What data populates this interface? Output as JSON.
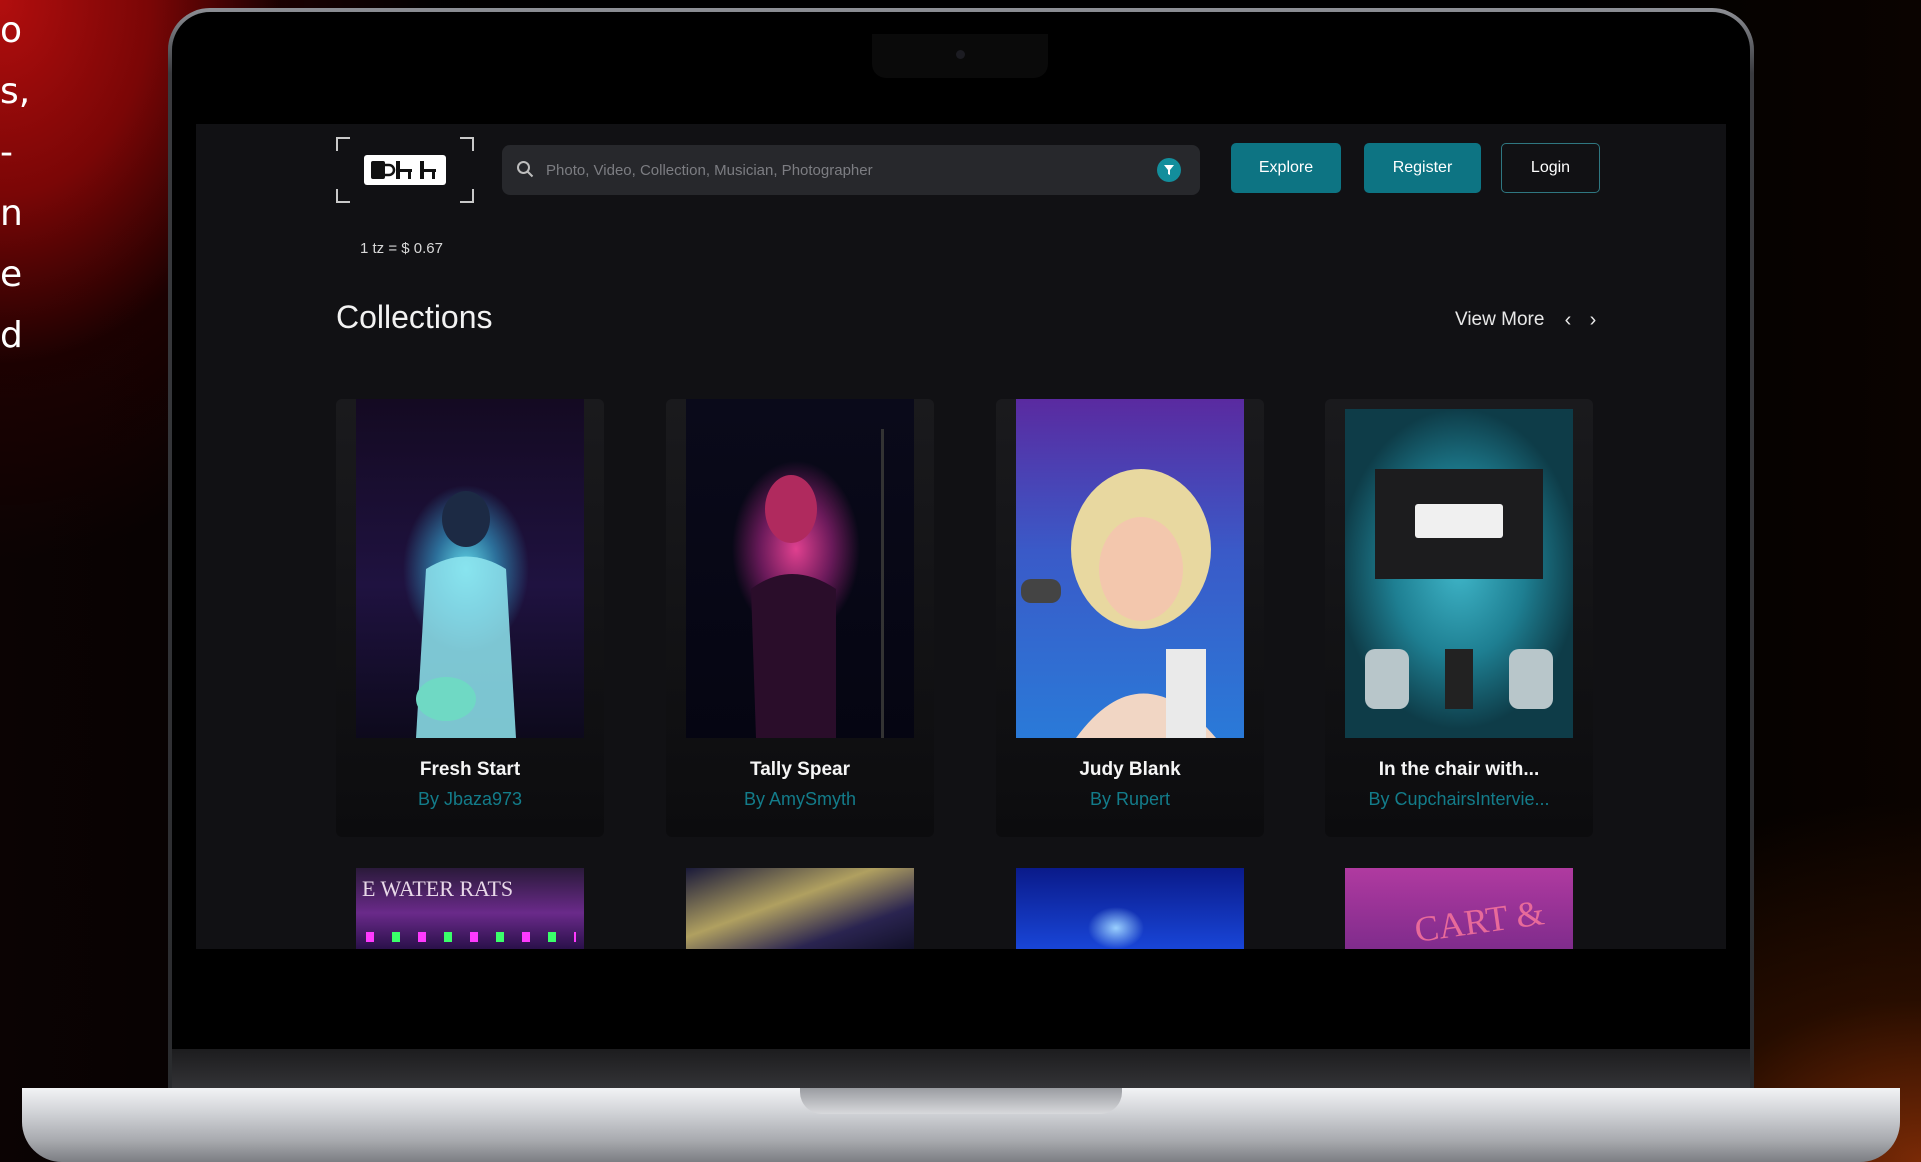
{
  "side_text": [
    "o",
    "s,",
    "-",
    "n",
    "e",
    "d"
  ],
  "header": {
    "rate": "1 tz = $ 0.67",
    "search_placeholder": "Photo, Video, Collection, Musician, Photographer",
    "buttons": {
      "explore": "Explore",
      "register": "Register",
      "login": "Login"
    }
  },
  "collections": {
    "title": "Collections",
    "view_more": "View More",
    "prev_icon": "‹",
    "next_icon": "›",
    "cards": [
      {
        "title": "Fresh Start",
        "author": "By Jbaza973"
      },
      {
        "title": "Tally Spear",
        "author": "By AmySmyth"
      },
      {
        "title": "Judy Blank",
        "author": "By Rupert"
      },
      {
        "title": "In the chair with...",
        "author": "By CupchairsIntervie..."
      }
    ],
    "row2_images": [
      {
        "text": "E WATER RATS"
      },
      {
        "text": ""
      },
      {
        "text": ""
      },
      {
        "text": "CART & H"
      }
    ]
  },
  "colors": {
    "accent": "#0d7483",
    "author": "#137c8a",
    "background": "#111114"
  }
}
